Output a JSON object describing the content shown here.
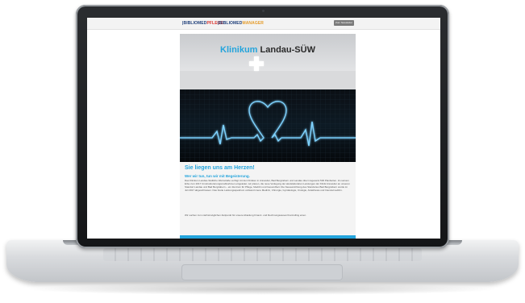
{
  "site": {
    "logo_b1": "|BIBLIOMED",
    "logo_p1": "PFLEGE",
    "logo_b2": "|BIBLIOMED",
    "logo_m2": "MANAGER",
    "header_button": "Zum Newsletter"
  },
  "hero": {
    "title_accent": "Klinikum",
    "title_rest": " Landau-SÜW"
  },
  "content": {
    "headline": "Sie liegen uns am Herzen!",
    "subhead": "Wer wir tun, tun wir mit Begeisterung.",
    "paragraph1": "Das Klinikum Landau-Südliche Weinstraße verfügt mit den Kliniken in Annweiler, Bad Bergzabern und Landau über insgesamt 500 Planbetten. Zu seinem Erbe zum 2017 Umstrukturierungsmaßnahmen eingeleitet, wir planen, die neue Verlegung der akutstationären Leistungen der Klinik Annweiler an unseren Standort Landau und Bad Bergzabern – ein Zentrum für Pflege, Medizin und Gesundheit. Die Neuausrichtung des Standortes Bad Bergzabern wurde im Juli 2017 abgeschlossen. Das breite Leistungsspektrum umfasst Innere Medizin, Chirurgie, Gynäkologie, Urologie, Anästhesie und Intensivmedizin.",
    "paragraph2": "Wir suchen zum nächstmöglichen Zeitpunkt für unsere Abteilung Finanz- und Rechnungswesen/Controlling einen"
  },
  "icons": {
    "cross": "medical-cross-icon",
    "heart": "heartbeat-heart-icon"
  },
  "colors": {
    "accent": "#23a4dc",
    "logo_blue": "#1f3f7a",
    "logo_red": "#d9332d",
    "logo_orange": "#e59c2a"
  }
}
